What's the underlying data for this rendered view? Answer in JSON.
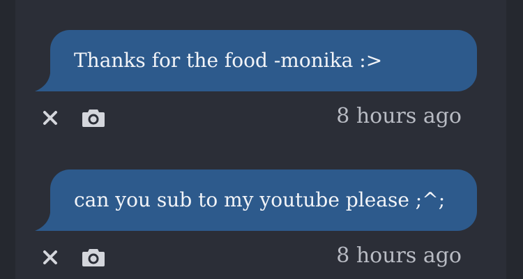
{
  "messages": [
    {
      "text": "Thanks for the food -monika :>",
      "time": "8 hours ago",
      "actions": {
        "delete_icon": "close-icon",
        "camera_icon": "camera-icon"
      }
    },
    {
      "text": "can you sub to my youtube please ;^;",
      "time": "8 hours ago",
      "actions": {
        "delete_icon": "close-icon",
        "camera_icon": "camera-icon"
      }
    }
  ],
  "colors": {
    "background": "#2b2e37",
    "bubble": "#2d5a8c",
    "bubble_text": "#f2f4f8",
    "meta_text": "#b9bcc4",
    "icon": "#d4d6dc"
  }
}
